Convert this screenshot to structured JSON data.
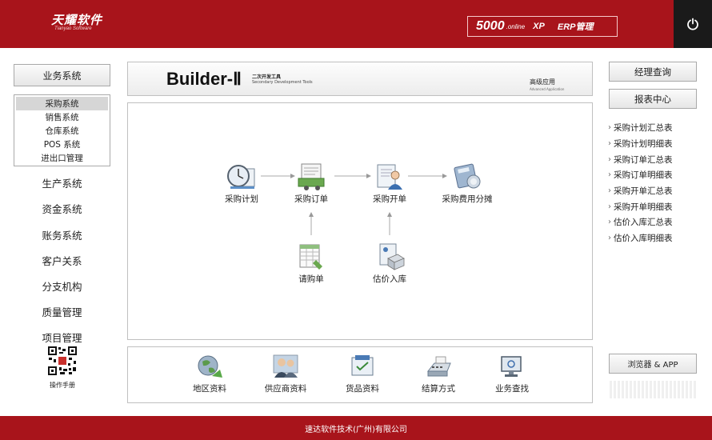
{
  "header": {
    "logo_text": "天耀软件",
    "logo_sub": "Tianyao Software",
    "badge_number": "5000",
    "badge_online": ".online",
    "badge_xp": "XP",
    "badge_erp": "ERP管理",
    "power_icon": "power-icon"
  },
  "nav": {
    "business_system": "业务系统",
    "sub_items": [
      "采购系统",
      "销售系统",
      "仓库系统",
      "POS 系统",
      "进出口管理"
    ],
    "items": [
      "生产系统",
      "资金系统",
      "账务系统",
      "客户关系",
      "分支机构",
      "质量管理",
      "项目管理"
    ],
    "manual": "操作手册"
  },
  "banner": {
    "title": "Builder-Ⅱ",
    "subtitle_cn": "二次开发工具",
    "subtitle_en": "Secondary Development Tools",
    "advanced_cn": "高级应用",
    "advanced_en": "Advanced Application"
  },
  "flow": {
    "purchase_plan": "采购计划",
    "purchase_order": "采购订单",
    "purchase_invoice": "采购开单",
    "purchase_cost": "采购费用分摊",
    "requisition": "请购单",
    "estimate_inbound": "估价入库"
  },
  "tools": [
    "地区资料",
    "供应商资料",
    "货品资料",
    "结算方式",
    "业务查找"
  ],
  "right": {
    "manager_query": "经理查询",
    "report_center": "报表中心",
    "reports": [
      "采购计划汇总表",
      "采购计划明细表",
      "采购订单汇总表",
      "采购订单明细表",
      "采购开单汇总表",
      "采购开单明细表",
      "估价入库汇总表",
      "估价入库明细表"
    ],
    "browser_app": "浏览器 & APP"
  },
  "footer": {
    "company": "速达软件技术(广州)有限公司"
  },
  "colors": {
    "brand_red": "#a8141b",
    "power_bg": "#1a1a1a"
  }
}
